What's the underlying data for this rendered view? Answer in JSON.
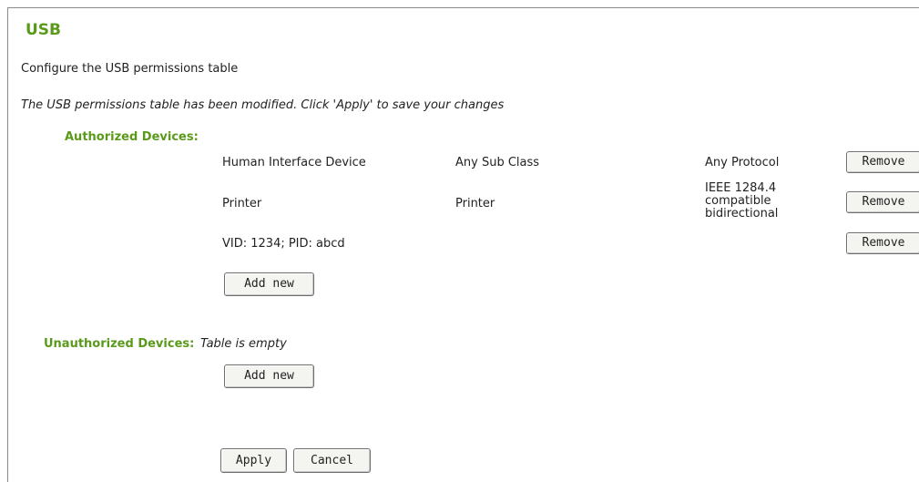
{
  "page": {
    "title": "USB",
    "description": "Configure the USB permissions table",
    "notice": "The USB permissions table has been modified. Click 'Apply' to save your changes"
  },
  "authorized": {
    "label": "Authorized Devices:",
    "rows": [
      {
        "device": "Human Interface Device",
        "subclass": "Any Sub Class",
        "protocol": "Any Protocol",
        "remove_label": "Remove"
      },
      {
        "device": "Printer",
        "subclass": "Printer",
        "protocol": "IEEE 1284.4 compatible bidirectional",
        "remove_label": "Remove"
      },
      {
        "device": "VID: 1234; PID: abcd",
        "subclass": "",
        "protocol": "",
        "remove_label": "Remove"
      }
    ],
    "add_new_label": "Add new"
  },
  "unauthorized": {
    "label": "Unauthorized Devices:",
    "empty_text": "Table is empty",
    "add_new_label": "Add new"
  },
  "actions": {
    "apply_label": "Apply",
    "cancel_label": "Cancel"
  },
  "colors": {
    "accent": "#5a9a1a",
    "text": "#222222",
    "button_bg": "#f4f4f0",
    "button_border": "#6e6e6e"
  }
}
